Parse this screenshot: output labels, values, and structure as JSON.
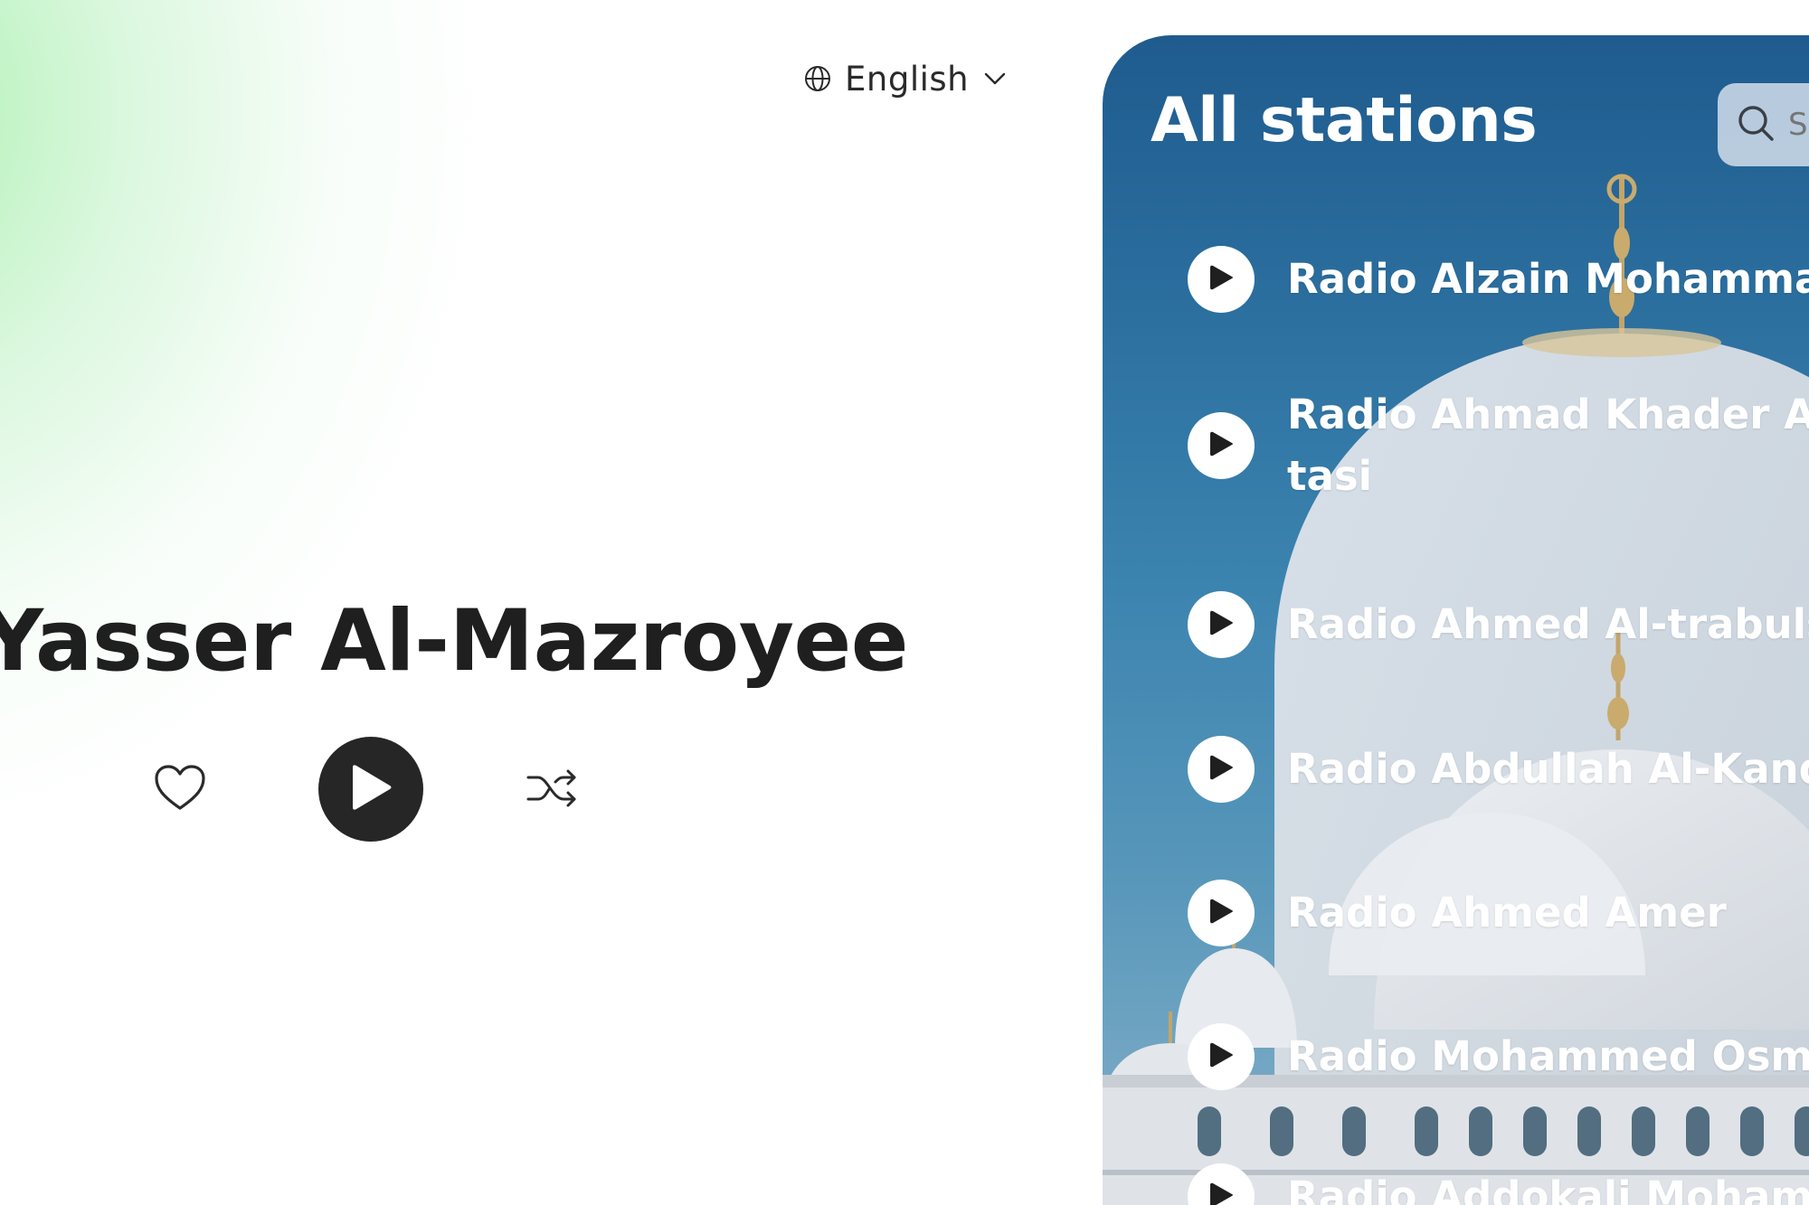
{
  "language": {
    "label": "English",
    "icon": "globe-icon",
    "chevron": "chevron-down-icon"
  },
  "hero": {
    "title": "Yasser Al-Mazroyee",
    "controls": {
      "favorite_icon": "heart-icon",
      "play_icon": "play-icon",
      "shuffle_icon": "shuffle-icon"
    }
  },
  "stations_panel": {
    "title": "All stations",
    "search": {
      "icon": "search-icon",
      "placeholder": "S"
    },
    "stations": [
      {
        "name": "Radio Alzain Mohamma"
      },
      {
        "name": "Radio Ahmad Khader Atasi"
      },
      {
        "name": "Radio Ahmed Al-trabuls"
      },
      {
        "name": "Radio Abdullah Al-Kand"
      },
      {
        "name": "Radio Ahmed Amer"
      },
      {
        "name": "Radio Mohammed Osma"
      },
      {
        "name": "Radio Addokali Mohamm"
      }
    ],
    "colors": {
      "panel_top": "#1f5b8e",
      "panel_bottom": "#8fb6cc",
      "text": "#ffffff"
    }
  },
  "colors": {
    "accent_dark": "#262626",
    "hero_gradient": "#aaf0af"
  }
}
